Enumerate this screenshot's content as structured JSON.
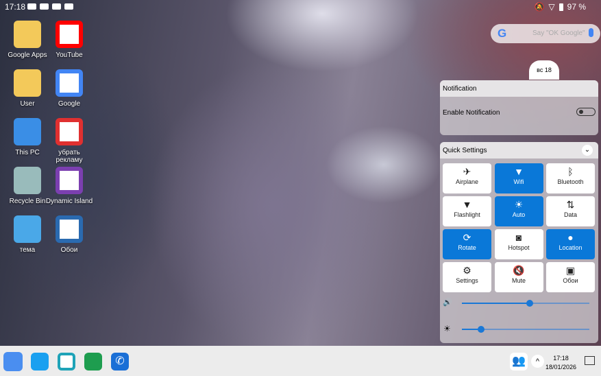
{
  "status_bar": {
    "time": "17:18",
    "battery": "97 %"
  },
  "search": {
    "placeholder": "Say \"OK Google\"",
    "logo": "G"
  },
  "desktop_icons": [
    {
      "label": "Google Apps",
      "icon": "folder-icon",
      "color": "#f3c95a"
    },
    {
      "label": "YouTube",
      "icon": "youtube-icon",
      "color": "#ff0000"
    },
    {
      "label": "User",
      "icon": "user-folder-icon",
      "color": "#f3c95a"
    },
    {
      "label": "Google",
      "icon": "google-icon",
      "color": "#4285f4"
    },
    {
      "label": "This PC",
      "icon": "computer-icon",
      "color": "#3a8ee6"
    },
    {
      "label": "убрать рекламу",
      "icon": "no-ads-icon",
      "color": "#e03030"
    },
    {
      "label": "Recycle Bin",
      "icon": "recycle-bin-icon",
      "color": "#9bb"
    },
    {
      "label": "Dynamic Island",
      "icon": "dynamic-island-icon",
      "color": "#7b3fb0"
    },
    {
      "label": "тема",
      "icon": "theme-icon",
      "color": "#4aa8e8"
    },
    {
      "label": "Обои",
      "icon": "wallpaper-icon",
      "color": "#2a6ab0"
    }
  ],
  "date_badge": "вс 18",
  "notification": {
    "title": "Notification",
    "enable_label": "Enable Notification",
    "enabled": false
  },
  "quick_settings": {
    "title": "Quick Settings",
    "tiles": [
      {
        "label": "Airplane",
        "icon": "✈",
        "on": false
      },
      {
        "label": "Wifi",
        "icon": "▼",
        "on": true
      },
      {
        "label": "Bluetooth",
        "icon": "ᛒ",
        "on": false
      },
      {
        "label": "Flashlight",
        "icon": "▼",
        "on": false
      },
      {
        "label": "Auto",
        "icon": "☀",
        "on": true
      },
      {
        "label": "Data",
        "icon": "⇅",
        "on": false
      },
      {
        "label": "Rotate",
        "icon": "⟳",
        "on": true
      },
      {
        "label": "Hotspot",
        "icon": "◙",
        "on": false
      },
      {
        "label": "Location",
        "icon": "●",
        "on": true
      },
      {
        "label": "Settings",
        "icon": "⚙",
        "on": false
      },
      {
        "label": "Mute",
        "icon": "🔇",
        "on": false
      },
      {
        "label": "Обои",
        "icon": "▣",
        "on": false
      }
    ],
    "volume": 0.53,
    "brightness": 0.15
  },
  "taskbar": {
    "time": "17:18",
    "date": "18/01/2026",
    "accent": "#1a78d6"
  }
}
